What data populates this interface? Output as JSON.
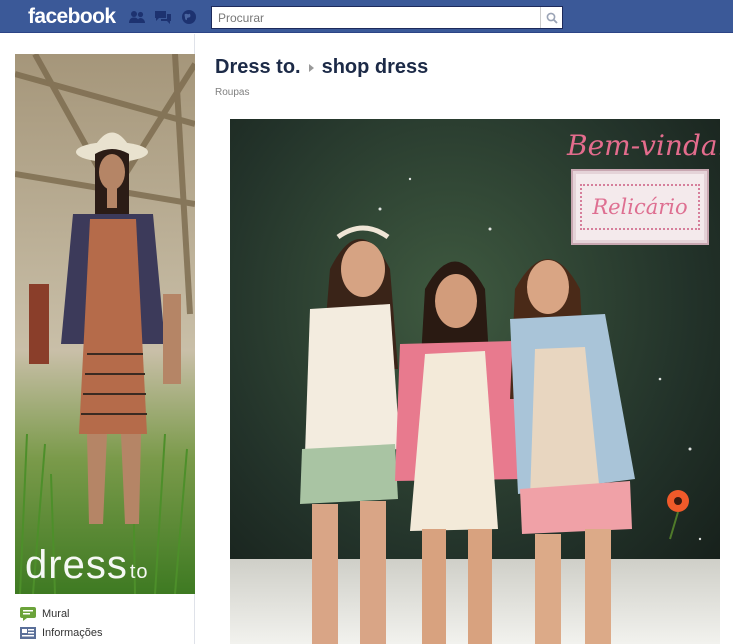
{
  "topbar": {
    "logo": "facebook",
    "search": {
      "placeholder": "Procurar",
      "value": ""
    },
    "jewels": [
      "friends-icon",
      "messages-icon",
      "notifications-globe-icon"
    ]
  },
  "left": {
    "brand_mark": "dress",
    "brand_mark_small": "to",
    "nav": [
      {
        "label": "Mural",
        "icon": "wall-icon"
      },
      {
        "label": "Informações",
        "icon": "info-icon"
      }
    ]
  },
  "main": {
    "breadcrumb": {
      "page": "Dress to.",
      "sub": "shop dress"
    },
    "category": "Roupas",
    "banner": {
      "greeting": "Bem-vinda!",
      "collection": "Relicário"
    }
  },
  "colors": {
    "fb_blue": "#3b5998",
    "title": "#1c2a47",
    "banner_pink": "#e46c8d"
  }
}
